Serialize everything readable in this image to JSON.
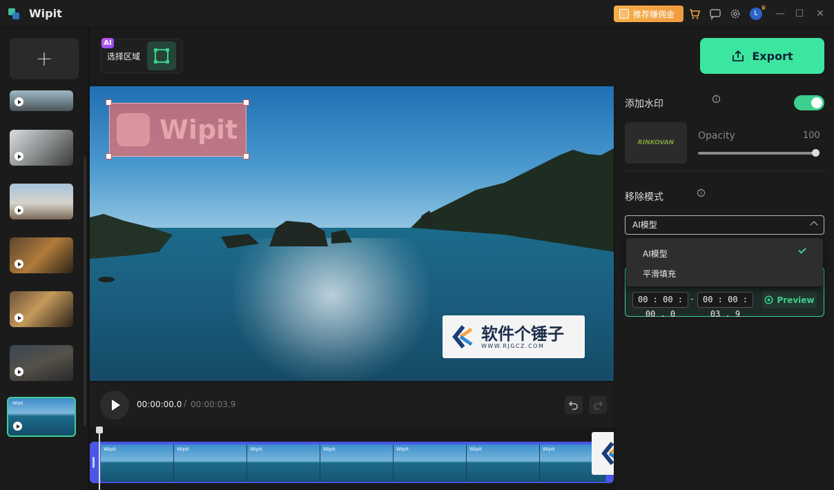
{
  "app": {
    "name": "Wipit"
  },
  "titlebar": {
    "promo_label": "推荐赚佣金",
    "icons": [
      "cart-icon",
      "feedback-icon",
      "settings-icon",
      "avatar-icon"
    ],
    "avatar_letter": "L"
  },
  "toolbar": {
    "ai_badge": "AI",
    "select_area_label": "选择区域",
    "export_label": "Export"
  },
  "preview": {
    "watermark_text": "Wipit",
    "site_badge": {
      "name": "软件个锤子",
      "url": "WWW.RJGCZ.COM"
    }
  },
  "playback": {
    "current_time": "00:00:00.0",
    "separator": "/",
    "total_time": "00:00:03.9"
  },
  "timeline": {
    "frame_label": "Wipit",
    "frame_count": 7
  },
  "panel": {
    "add_watermark_label": "添加水印",
    "add_watermark_enabled": true,
    "opacity_label": "Opacity",
    "opacity_value": "100",
    "watermark_thumb_text": "RINKOVAN",
    "remove_mode_label": "移除模式",
    "remove_mode_selected": "AI模型",
    "remove_mode_options": [
      "AI模型",
      "平滑填充"
    ],
    "range_start": "00 : 00 : 00 . 0",
    "range_dash": "-",
    "range_end": "00 : 00 : 03 . 9",
    "preview_label": "Preview"
  },
  "colors": {
    "accent": "#3ccf8e",
    "export": "#3ce5a0",
    "track": "#4a56e6",
    "promo": "#f5a443"
  }
}
